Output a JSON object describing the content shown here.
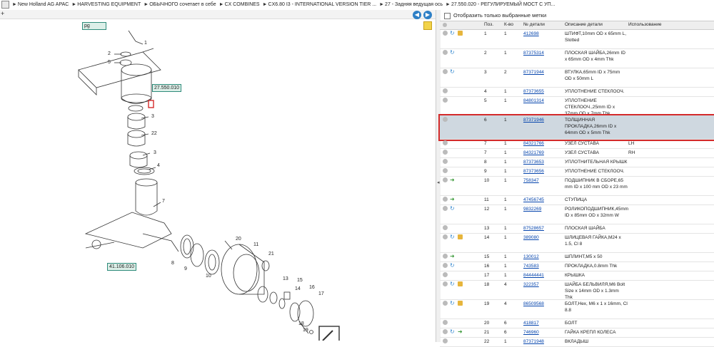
{
  "breadcrumb": [
    "New Holland AG APAC",
    "HARVESTING EQUIPMENT",
    "ОБЫЧНОГО сочетает в себе",
    "CX COMBINES",
    "CX6.80 I3 - INTERNATIONAL VERSION TIER ...",
    "27 - Задняя ведущая ось",
    "27.550.020 - РЕГУЛИРУЕМЫЙ МОСТ С УП..."
  ],
  "toolbar": {
    "zoom_label": "+",
    "prev": "◀",
    "next": "▶"
  },
  "filter": {
    "label": "Отобразить только выбранные метки"
  },
  "columns": {
    "pos": "Поз.",
    "qty": "К-во",
    "partno": "№ детали",
    "desc": "Описание детали",
    "usage": "Использование"
  },
  "diagram": {
    "refs": [
      "27.550.010",
      "41.106.010"
    ],
    "labels": [
      "1",
      "2",
      "5",
      "3",
      "22",
      "3",
      "4",
      "7",
      "20",
      "11",
      "21",
      "8",
      "9",
      "10",
      "13",
      "15",
      "14",
      "16",
      "17",
      "18",
      "19"
    ],
    "icon_page": "pg"
  },
  "parts": [
    {
      "pos": "1",
      "qty": "1",
      "no": "412698",
      "desc": "ШТИФТ,10mm OD x 65mm L, Slotted",
      "use": "",
      "icons": [
        "g",
        "b",
        "y"
      ]
    },
    {
      "pos": "2",
      "qty": "1",
      "no": "87375314",
      "desc": "ПЛОСКАЯ ШАЙБА,26mm ID x 65mm OD x 4mm Thk",
      "use": "",
      "icons": [
        "g",
        "b"
      ]
    },
    {
      "pos": "3",
      "qty": "2",
      "no": "87371944",
      "desc": "ВТУЛКА,65mm ID x 75mm OD x 50mm L",
      "use": "",
      "icons": [
        "g",
        "b"
      ]
    },
    {
      "pos": "4",
      "qty": "1",
      "no": "87373655",
      "desc": "УПЛОТНЕНИЕ СТЕКЛООЧ.",
      "use": "",
      "icons": [
        "g"
      ]
    },
    {
      "pos": "5",
      "qty": "1",
      "no": "84801314",
      "desc": "УПЛОТНЕНИЕ СТЕКЛООЧ.,25mm ID x 37mm OD x 7mm Thk",
      "use": "",
      "icons": [
        "g"
      ]
    },
    {
      "pos": "6",
      "qty": "1",
      "no": "87371946",
      "desc": "ТОЛЩИННАЯ ПРОКЛАДКА,26mm ID x 64mm OD x 5mm Thk",
      "use": "",
      "icons": [
        "g"
      ],
      "selected": true
    },
    {
      "pos": "7",
      "qty": "1",
      "no": "84321766",
      "desc": "УЗЕЛ СУСТАВА",
      "use": "LH",
      "icons": [
        "g"
      ]
    },
    {
      "pos": "7",
      "qty": "1",
      "no": "84321769",
      "desc": "УЗЕЛ СУСТАВА",
      "use": "RH",
      "icons": [
        "g"
      ]
    },
    {
      "pos": "8",
      "qty": "1",
      "no": "87373653",
      "desc": "УПЛОТНИТЕЛЬНАЯ КРЫШК",
      "use": "",
      "icons": [
        "g"
      ]
    },
    {
      "pos": "9",
      "qty": "1",
      "no": "87373656",
      "desc": "УПЛОТНЕНИЕ СТЕКЛООЧ.",
      "use": "",
      "icons": [
        "g"
      ]
    },
    {
      "pos": "10",
      "qty": "1",
      "no": "758347",
      "desc": "ПОДШИПНИК В СБОРЕ,65 mm ID x 100 mm OD x 23 mm",
      "use": "",
      "icons": [
        "g",
        "gr"
      ]
    },
    {
      "pos": "11",
      "qty": "1",
      "no": "47456745",
      "desc": "СТУПИЦА",
      "use": "",
      "icons": [
        "g",
        "gr"
      ]
    },
    {
      "pos": "12",
      "qty": "1",
      "no": "9832269",
      "desc": "РОЛИКОПОДШИПНИК,45mm ID x 85mm OD x 32mm W",
      "use": "",
      "icons": [
        "g",
        "b"
      ]
    },
    {
      "pos": "13",
      "qty": "1",
      "no": "87528657",
      "desc": "ПЛОСКАЯ ШАЙБА",
      "use": "",
      "icons": [
        "g"
      ]
    },
    {
      "pos": "14",
      "qty": "1",
      "no": "389080",
      "desc": "ШЛИЦЕВАЯ ГАЙКА,M24 x 1.5, Cl 8",
      "use": "",
      "icons": [
        "g",
        "b",
        "y"
      ]
    },
    {
      "pos": "15",
      "qty": "1",
      "no": "130012",
      "desc": "ШПЛИНТ,M5 x 50",
      "use": "",
      "icons": [
        "g",
        "gr"
      ]
    },
    {
      "pos": "16",
      "qty": "1",
      "no": "743583",
      "desc": "ПРОКЛАДКА,0.8mm Thk",
      "use": "",
      "icons": [
        "g",
        "b"
      ]
    },
    {
      "pos": "17",
      "qty": "1",
      "no": "84444441",
      "desc": "КРЫШКА",
      "use": "",
      "icons": [
        "g"
      ]
    },
    {
      "pos": "18",
      "qty": "4",
      "no": "322357",
      "desc": "ШАЙБА БЕЛЬВИЛЯ,M6 Bolt Size x 14mm OD x 1.3mm Thk",
      "use": "",
      "icons": [
        "g",
        "b",
        "y"
      ]
    },
    {
      "pos": "19",
      "qty": "4",
      "no": "86509568",
      "desc": "БОЛТ,Hex, M6 x 1 x 16mm, Cl 8.8",
      "use": "",
      "icons": [
        "g",
        "b",
        "y"
      ]
    },
    {
      "pos": "20",
      "qty": "6",
      "no": "418817",
      "desc": "БОЛТ",
      "use": "",
      "icons": [
        "g"
      ]
    },
    {
      "pos": "21",
      "qty": "6",
      "no": "746960",
      "desc": "ГАЙКА КРЕПЛ КОЛЕСА",
      "use": "",
      "icons": [
        "g",
        "b",
        "gr"
      ]
    },
    {
      "pos": "22",
      "qty": "1",
      "no": "87371948",
      "desc": "ВКЛАДЫШ",
      "use": "",
      "icons": [
        "g"
      ]
    }
  ]
}
